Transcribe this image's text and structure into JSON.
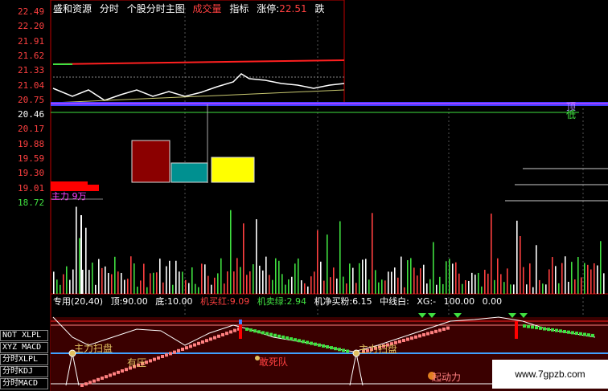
{
  "header": {
    "stock_name": "盛和资源",
    "tab_intraday": "分时",
    "tab_main_chart": "个股分时主图",
    "tab_trade_label": "成交量",
    "tab_indicator": "指标",
    "limit_up_label": "涨停:",
    "limit_up_value": "22.51",
    "limit_down_label": "跌"
  },
  "price_axis": {
    "labels": [
      "22.49",
      "22.20",
      "21.91",
      "21.62",
      "21.33",
      "21.04",
      "20.75",
      "20.46",
      "20.17",
      "19.88",
      "19.59",
      "19.30",
      "19.01",
      "18.72"
    ]
  },
  "right_labels": {
    "high_marker": "顶",
    "low_marker": "低"
  },
  "main_force": {
    "label": "主力",
    "value": "9万"
  },
  "indicator_bar": {
    "prefix": "专用(20,40)",
    "top_label": "顶:",
    "top_value": "90.00",
    "bottom_label": "底:",
    "bottom_value": "10.00",
    "buy_label": "机买红:",
    "buy_value": "9.09",
    "sell_label": "机卖绿:",
    "sell_value": "2.94",
    "net_label": "机净买粉:",
    "net_value": "6.15",
    "mid_label": "中线白:",
    "xg_label": "XG:",
    "xg_value": "-",
    "extra_value": "100.00",
    "extra_suffix": "0.00"
  },
  "left_buttons": [
    "NOT XLPL",
    "XYZ MACD",
    "分时XLPL",
    "分时KDJ",
    "分时MACD"
  ],
  "chart_tags": {
    "main_sweep_1": "主力扫盘",
    "main_sweep_2": "主力扫盘",
    "ice": "有压",
    "dead_team": "敢死队",
    "start_power": "起动力"
  },
  "watermark": "www.7gpzb.com",
  "colors": {
    "up": "#ff3030",
    "down": "#40e040",
    "axis": "#c00000",
    "white": "#ffffff"
  }
}
